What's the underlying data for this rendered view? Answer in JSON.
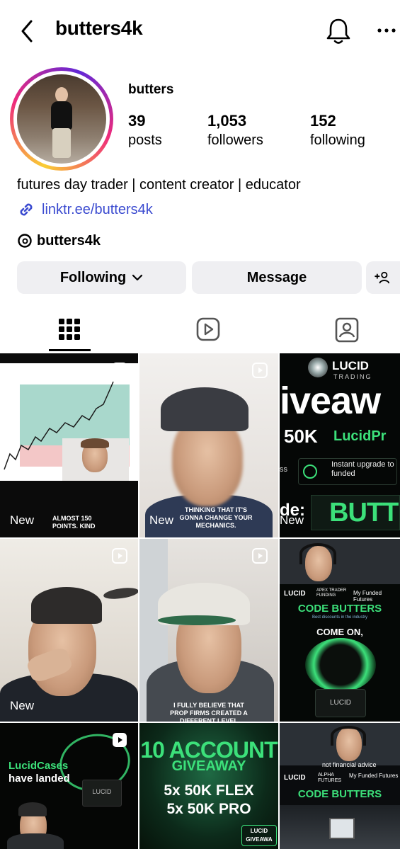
{
  "header": {
    "username": "butters4k"
  },
  "profile": {
    "display_name": "butters",
    "stats": [
      {
        "value": "39",
        "label": "posts"
      },
      {
        "value": "1,053",
        "label": "followers"
      },
      {
        "value": "152",
        "label": "following"
      }
    ],
    "bio": "futures day trader | content creator | educator",
    "link": "linktr.ee/butters4k",
    "threads_handle": "butters4k"
  },
  "actions": {
    "following": "Following",
    "message": "Message"
  },
  "grid": {
    "t1": {
      "new": "New",
      "caption": "ALMOST 150 POINTS. KIND"
    },
    "t2": {
      "new": "New",
      "caption": "THINKING THAT IT'S GONNA CHANGE YOUR MECHANICS."
    },
    "t3": {
      "brand": "LUCID",
      "brand_sub": "TRADING",
      "big": "iveaw",
      "amount": "50K",
      "amount_suffix": "LucidPr",
      "feature": "Instant upgrade to funded",
      "left_frag": "ss",
      "code_frag": "de:",
      "code": "BUTT",
      "new": "New"
    },
    "t4": {
      "new": "New"
    },
    "t5": {
      "caption": "I FULLY BELIEVE THAT PROP FIRMS CREATED A DIFFERENT LEVEL"
    },
    "t6": {
      "brand": "LUCID",
      "apex": "APEX TRADER FUNDING",
      "mff": "My Funded Futures",
      "code": "CODE BUTTERS",
      "sub": "Best discounts in the industry",
      "come_on": "COME ON,",
      "box": "LUCID"
    },
    "t7": {
      "line1": "LucidCases",
      "line2": "have landed",
      "box": "LUCID"
    },
    "t8": {
      "title1": "10 ACCOUNT",
      "title2": "GIVEAWAY",
      "line1": "5x 50K FLEX",
      "line2": "5x 50K PRO",
      "stamp": "LUCID GIVEAWA"
    },
    "t9": {
      "disclaimer": "not financial advice",
      "brand": "LUCID",
      "alpha": "ALPHA FUTURES",
      "mff": "My Funded Futures",
      "code": "CODE BUTTERS"
    }
  },
  "colors": {
    "accent_link": "#3b4bd0",
    "button_bg": "#efeff2",
    "lucid_green": "#3ce07a"
  }
}
